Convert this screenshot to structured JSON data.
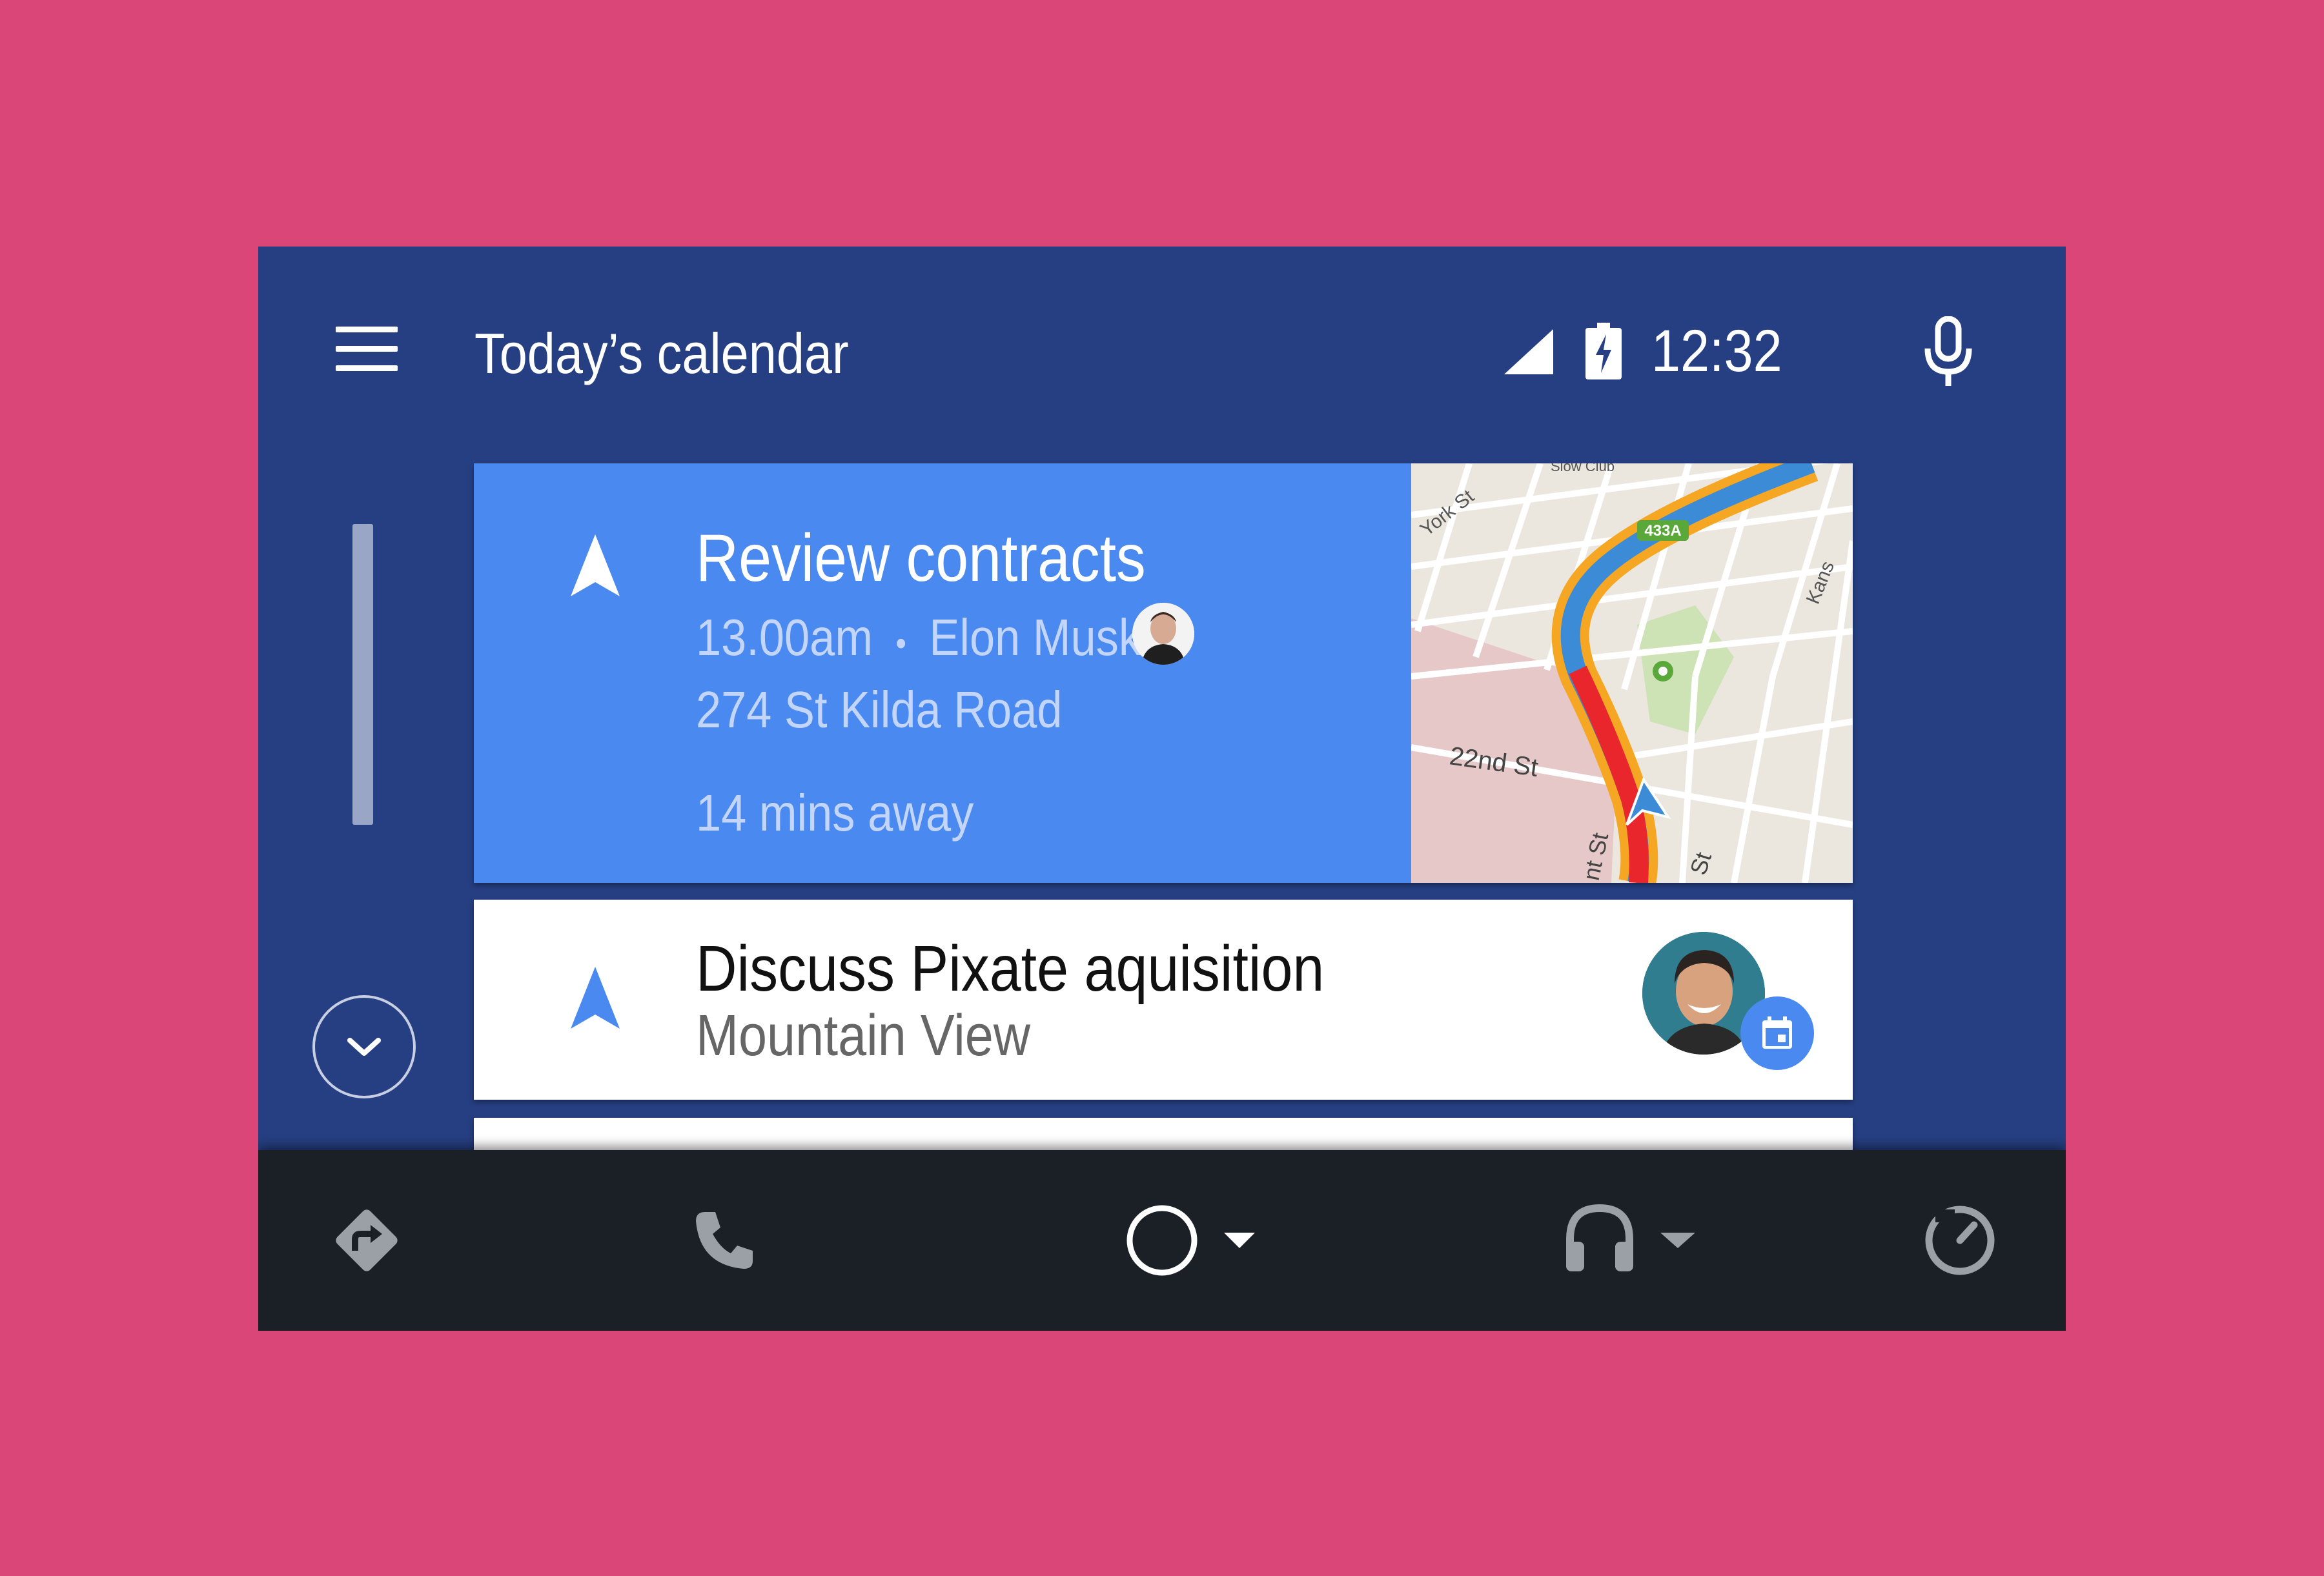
{
  "header": {
    "title": "Today’s calendar",
    "time": "12:32",
    "icons": [
      "menu-icon",
      "cellular-signal-icon",
      "battery-charging-icon",
      "microphone-icon"
    ]
  },
  "cards": [
    {
      "title": "Review contracts",
      "time": "13.00am",
      "separator": "•",
      "person": "Elon Musk",
      "address": "274 St Kilda Road",
      "eta": "14 mins away",
      "map_labels": {
        "york": "York St",
        "slow_club": "Slow Club",
        "exit": "433A",
        "kansas": "Kans",
        "st22": "22nd St",
        "front": "nt St",
        "other": "St"
      }
    },
    {
      "title": "Discuss Pixate aquisition",
      "subtitle": "Mountain View"
    }
  ],
  "bottom_nav": [
    "navigation-icon",
    "phone-icon",
    "home-icon",
    "headphones-icon",
    "dashboard-icon"
  ],
  "colors": {
    "background": "#d94677",
    "screen": "#263f82",
    "card_accent": "#4a89f0",
    "bottom_bar": "#1b2027"
  }
}
